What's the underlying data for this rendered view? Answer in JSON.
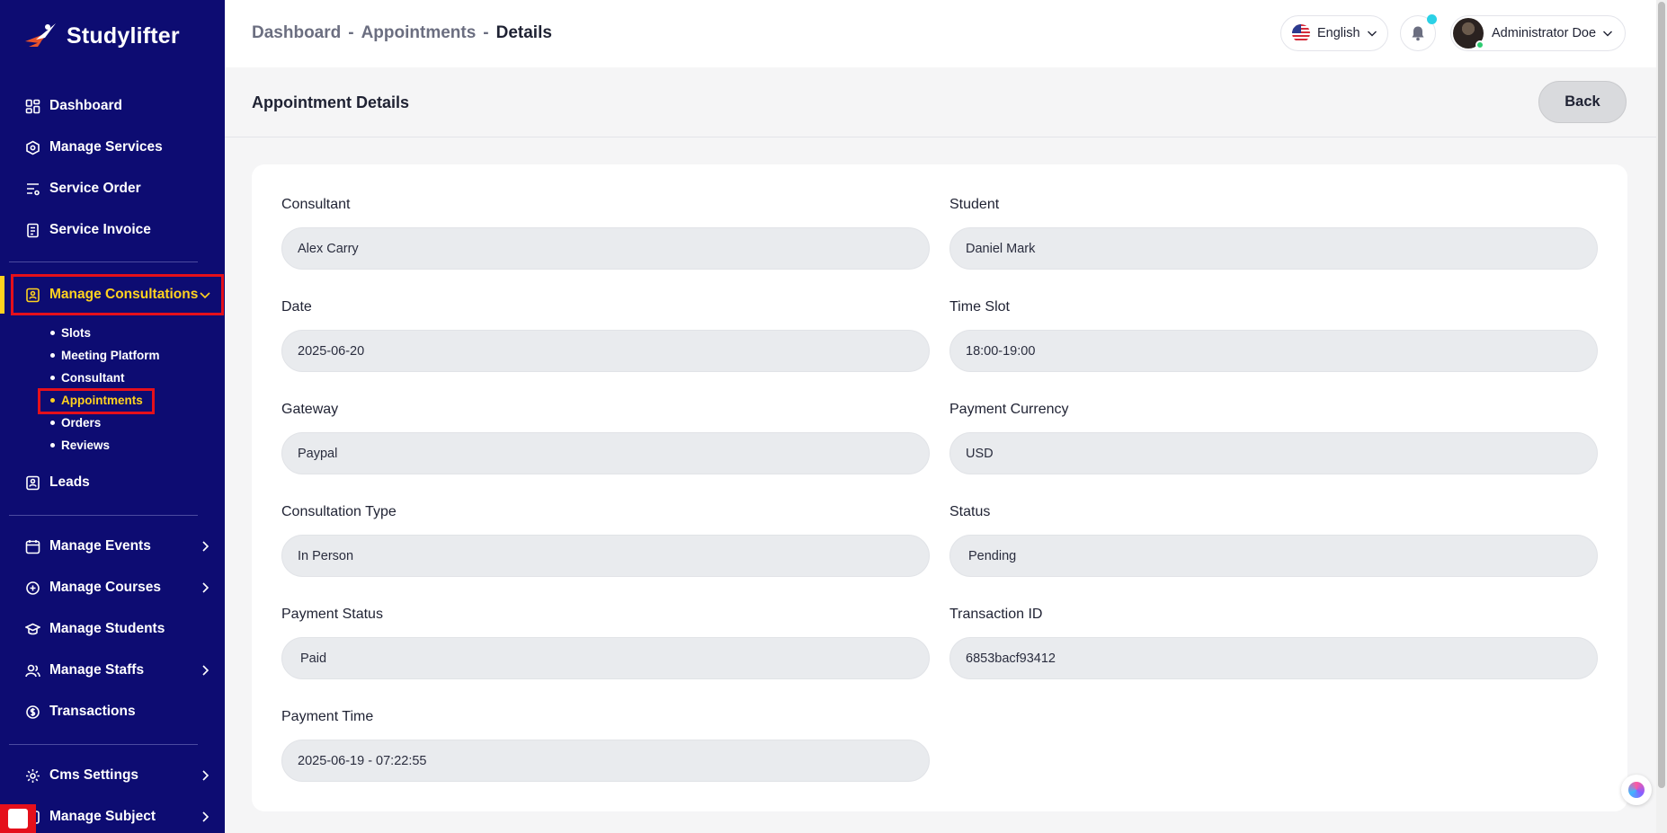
{
  "brand": {
    "name": "Studylifter"
  },
  "sidebar": {
    "items": [
      {
        "label": "Dashboard",
        "icon": "dashboard-icon"
      },
      {
        "label": "Manage Services",
        "icon": "services-icon"
      },
      {
        "label": "Service Order",
        "icon": "order-icon"
      },
      {
        "label": "Service Invoice",
        "icon": "invoice-icon"
      },
      {
        "label": "Manage Consultations",
        "icon": "consultation-icon"
      },
      {
        "label": "Leads",
        "icon": "leads-icon"
      },
      {
        "label": "Manage Events",
        "icon": "calendar-icon"
      },
      {
        "label": "Manage Courses",
        "icon": "courses-icon"
      },
      {
        "label": "Manage Students",
        "icon": "students-icon"
      },
      {
        "label": "Manage Staffs",
        "icon": "staffs-icon"
      },
      {
        "label": "Transactions",
        "icon": "transactions-icon"
      },
      {
        "label": "Cms Settings",
        "icon": "settings-icon"
      },
      {
        "label": "Manage Subject",
        "icon": "subject-icon"
      }
    ],
    "subitems": [
      {
        "label": "Slots"
      },
      {
        "label": "Meeting Platform"
      },
      {
        "label": "Consultant"
      },
      {
        "label": "Appointments"
      },
      {
        "label": "Orders"
      },
      {
        "label": "Reviews"
      }
    ]
  },
  "header": {
    "breadcrumb": [
      "Dashboard",
      "Appointments",
      "Details"
    ],
    "separator": "-",
    "language": "English",
    "user_name": "Administrator Doe"
  },
  "page": {
    "title": "Appointment Details",
    "back_label": "Back"
  },
  "fields": {
    "consultant": {
      "label": "Consultant",
      "value": "Alex Carry"
    },
    "student": {
      "label": "Student",
      "value": "Daniel Mark"
    },
    "date": {
      "label": "Date",
      "value": "2025-06-20"
    },
    "time_slot": {
      "label": "Time Slot",
      "value": "18:00-19:00"
    },
    "gateway": {
      "label": "Gateway",
      "value": "Paypal"
    },
    "payment_currency": {
      "label": "Payment Currency",
      "value": "USD"
    },
    "consultation_type": {
      "label": "Consultation Type",
      "value": "In Person"
    },
    "status": {
      "label": "Status",
      "value": "Pending"
    },
    "payment_status": {
      "label": "Payment Status",
      "value": "Paid"
    },
    "transaction_id": {
      "label": "Transaction ID",
      "value": "6853bacf93412"
    },
    "payment_time": {
      "label": "Payment Time",
      "value": "2025-06-19 - 07:22:55"
    }
  },
  "colors": {
    "sidebar": "#0d0c72",
    "accent": "#ffd21f",
    "highlight": "#e5101b"
  }
}
